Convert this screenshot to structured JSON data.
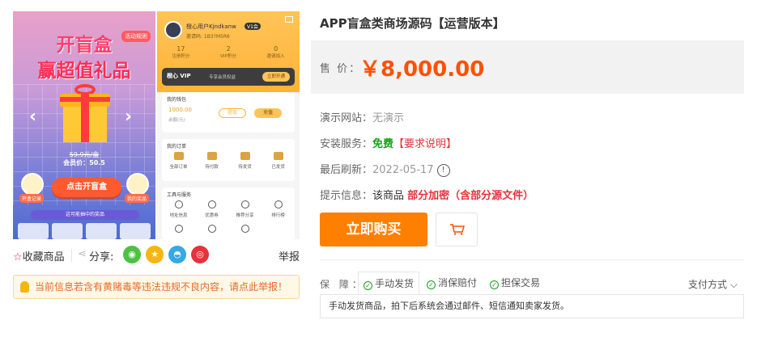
{
  "gallery": {
    "promo": {
      "tag": "活动规则",
      "title_line1": "开盲盒",
      "title_line2": "赢超值礼品",
      "old_price": "59.9元/盒",
      "member_price": "会员价：50.5",
      "open_button": "点击开盲盒",
      "left_badge": "开盒记录",
      "right_badge": "我的奖品",
      "prize_bar": "这可能抽中的奖品"
    },
    "profile": {
      "name": "橙心用户Kjndkanw",
      "badge": "V1会",
      "info": "邀请码: 1B3?M5R6",
      "stats": [
        {
          "num": "17",
          "label": "注册积分"
        },
        {
          "num": "2",
          "label": "VIP积分"
        },
        {
          "num": "0",
          "label": "邀请加入"
        }
      ],
      "vip": {
        "logo": "橙心 VIP",
        "desc": "专享会员权益",
        "button": "立即开通"
      },
      "wallet": {
        "header": "我的钱包",
        "amount": "1000.00",
        "label": "余额(元)",
        "btn1": "提现",
        "btn2": "充值"
      },
      "orders": {
        "header": "我的订单",
        "items": [
          "全部订单",
          "待付款",
          "待发货",
          "已发货"
        ]
      },
      "tools": {
        "header": "工具与服务",
        "row1": [
          "地址信息",
          "优惠券",
          "推荐分享",
          "排行榜"
        ],
        "row2": [
          "",
          "",
          "",
          ""
        ]
      }
    }
  },
  "actions": {
    "favorite": "收藏商品",
    "share": "分享:",
    "report": "举报"
  },
  "notice": "当前信息若含有黄赌毒等违法违规不良内容，请点此举报！",
  "product": {
    "title": "APP盲盒类商场源码【运营版本】",
    "price_label": "售 价：",
    "price": "￥8,000.00",
    "demo_label": "演示网站：",
    "demo_value": "无演示",
    "install_label": "安装服务：",
    "install_free": "免费",
    "install_req": "【要求说明】",
    "refresh_label": "最后刷新：",
    "refresh_value": "2022-05-17",
    "tip_label": "提示信息：",
    "tip_prefix": "该商品",
    "tip_highlight": "部分加密（含部分源文件）",
    "buy_button": "立即购买"
  },
  "guarantee": {
    "label": "保 障：",
    "tabs": [
      "手动发货",
      "消保赔付",
      "担保交易"
    ],
    "payment": "支付方式",
    "description": "手动发货商品，拍下后系统会通过邮件、短信通知卖家发货。"
  },
  "colors": {
    "price": "#ff5000",
    "buy": "#ff7f00",
    "warning": "#e6323b",
    "free": "#18a018"
  }
}
